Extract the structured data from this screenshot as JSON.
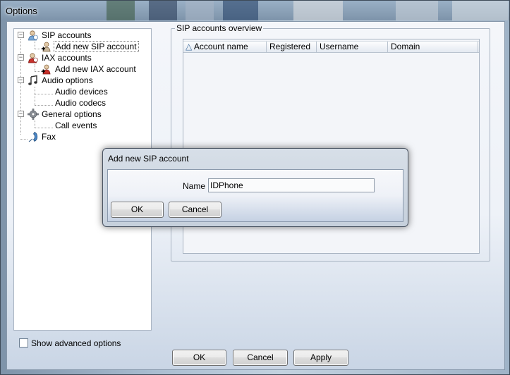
{
  "window": {
    "title": "Options"
  },
  "tree": {
    "items": [
      {
        "label": "SIP accounts",
        "icon": "sip-accounts-icon",
        "expander": "−"
      },
      {
        "label": "Add new SIP account",
        "icon": "add-sip-account-icon",
        "selected": true
      },
      {
        "label": "IAX accounts",
        "icon": "iax-accounts-icon",
        "expander": "−"
      },
      {
        "label": "Add new IAX account",
        "icon": "add-iax-account-icon"
      },
      {
        "label": "Audio options",
        "icon": "audio-note-icon",
        "expander": "−"
      },
      {
        "label": "Audio devices"
      },
      {
        "label": "Audio codecs"
      },
      {
        "label": "General options",
        "icon": "gear-icon",
        "expander": "−"
      },
      {
        "label": "Call events"
      },
      {
        "label": "Fax",
        "icon": "phone-handset-icon"
      }
    ]
  },
  "overview": {
    "group_label": "SIP accounts overview",
    "columns": [
      "Account name",
      "Registered",
      "Username",
      "Domain"
    ],
    "sort_indicator": "△",
    "rows": []
  },
  "advanced": {
    "label": "Show advanced options",
    "checked": false
  },
  "buttons": {
    "ok": "OK",
    "cancel": "Cancel",
    "apply": "Apply"
  },
  "dialog": {
    "title": "Add new SIP account",
    "name_label": "Name",
    "name_value": "IDPhone",
    "ok": "OK",
    "cancel": "Cancel"
  },
  "colors": {
    "accent": "#6d7f93",
    "selection_border": "#777777"
  }
}
